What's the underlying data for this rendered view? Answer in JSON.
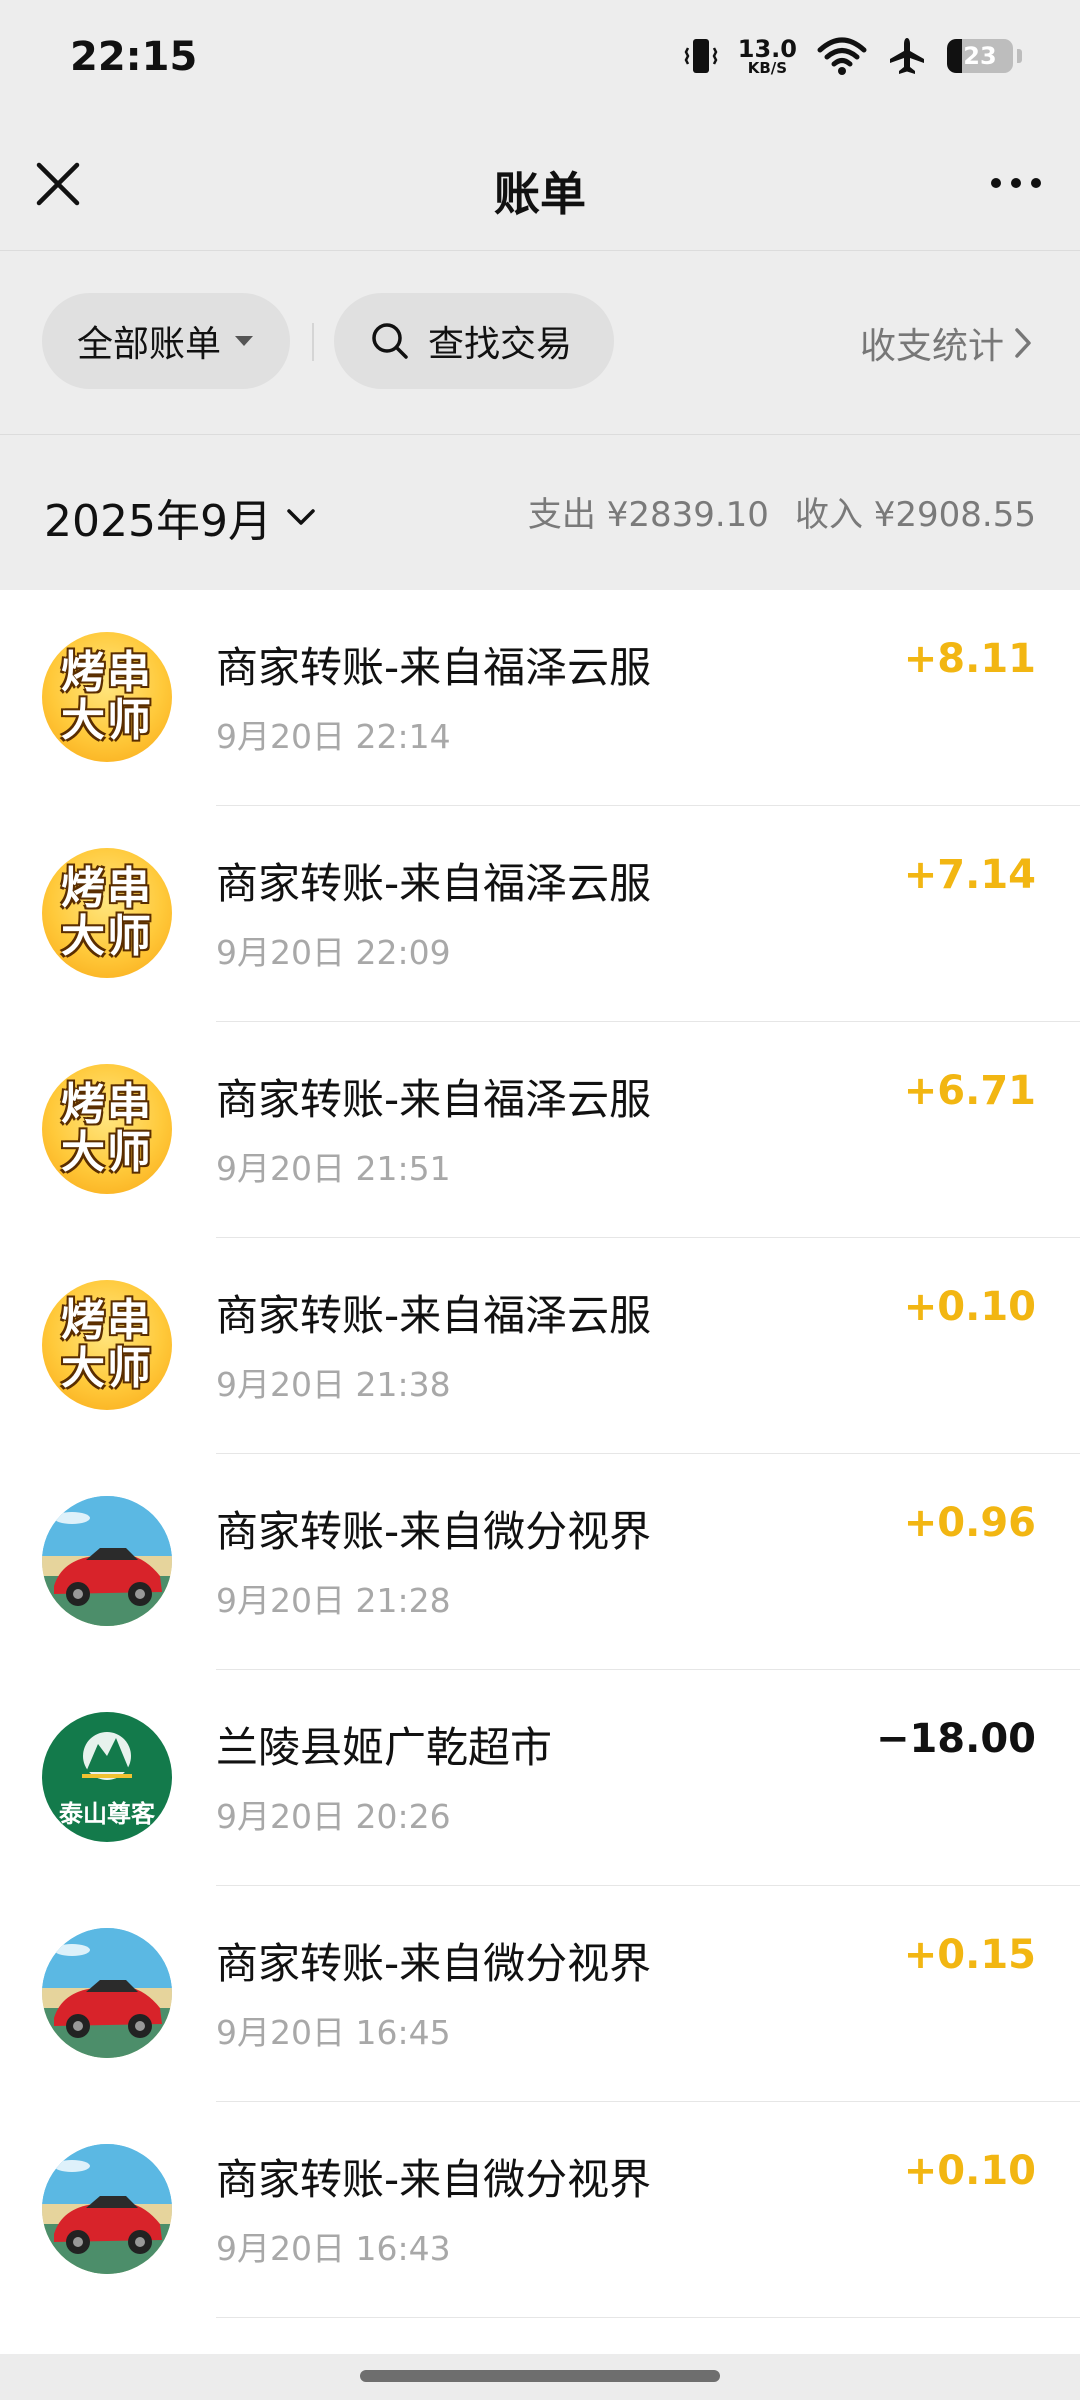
{
  "status_bar": {
    "time": "22:15",
    "net_speed_value": "13.0",
    "net_speed_unit": "KB/S",
    "battery": "23",
    "battery_level": 0.23,
    "icons": [
      "vibrate-icon",
      "wifi-icon",
      "airplane-icon",
      "battery-icon"
    ]
  },
  "nav": {
    "title": "账单",
    "close_icon": "close-icon",
    "more_icon": "more-icon"
  },
  "filter": {
    "all_bills": "全部账单",
    "search": "查找交易",
    "stats": "收支统计"
  },
  "month": {
    "label": "2025年9月",
    "expense": "支出 ¥2839.10",
    "income": "收入 ¥2908.55"
  },
  "transactions": [
    {
      "title": "商家转账-来自福泽云服",
      "time": "9月20日 22:14",
      "amount": "+8.11",
      "type": "income",
      "avatar": "烤串大师"
    },
    {
      "title": "商家转账-来自福泽云服",
      "time": "9月20日 22:09",
      "amount": "+7.14",
      "type": "income",
      "avatar": "烤串大师"
    },
    {
      "title": "商家转账-来自福泽云服",
      "time": "9月20日 21:51",
      "amount": "+6.71",
      "type": "income",
      "avatar": "烤串大师"
    },
    {
      "title": "商家转账-来自福泽云服",
      "time": "9月20日 21:38",
      "amount": "+0.10",
      "type": "income",
      "avatar": "烤串大师"
    },
    {
      "title": "商家转账-来自微分视界",
      "time": "9月20日 21:28",
      "amount": "+0.96",
      "type": "income",
      "avatar": "car"
    },
    {
      "title": "兰陵县姬广乾超市",
      "time": "9月20日 20:26",
      "amount": "−18.00",
      "type": "expense",
      "avatar": "泰山尊客"
    },
    {
      "title": "商家转账-来自微分视界",
      "time": "9月20日 16:45",
      "amount": "+0.15",
      "type": "income",
      "avatar": "car"
    },
    {
      "title": "商家转账-来自微分视界",
      "time": "9月20日 16:43",
      "amount": "+0.10",
      "type": "income",
      "avatar": "car"
    }
  ],
  "colors": {
    "income": "#f2b612",
    "expense": "#111111",
    "background": "#ededed"
  }
}
